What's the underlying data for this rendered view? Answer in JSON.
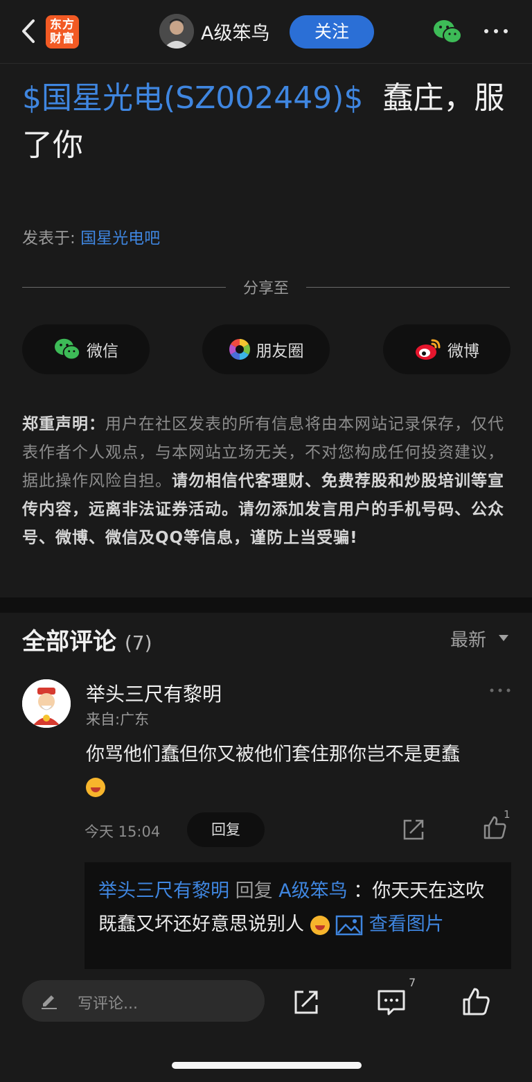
{
  "header": {
    "logo_text": "东方财富",
    "author": "A级笨鸟",
    "follow_label": "关注",
    "icons": [
      "back-icon",
      "wechat-icon",
      "more-icon"
    ]
  },
  "post": {
    "title_stock": "$国星光电(SZ002449)$",
    "title_text": "蠢庄，服了你",
    "posted_label": "发表于:",
    "posted_bar": "国星光电吧"
  },
  "share": {
    "label": "分享至",
    "buttons": [
      {
        "label": "微信",
        "icon": "wechat-icon"
      },
      {
        "label": "朋友圈",
        "icon": "moments-icon"
      },
      {
        "label": "微博",
        "icon": "weibo-icon"
      }
    ]
  },
  "disclaimer": {
    "prefix": "郑重声明：",
    "normal": "用户在社区发表的所有信息将由本网站记录保存，仅代表作者个人观点，与本网站立场无关，不对您构成任何投资建议，据此操作风险自担。",
    "bold": "请勿相信代客理财、免费荐股和炒股培训等宣传内容，远离非法证券活动。请勿添加发言用户的手机号码、公众号、微博、微信及QQ等信息，谨防上当受骗!"
  },
  "comments": {
    "heading": "全部评论",
    "count": "(7)",
    "sort": "最新",
    "items": [
      {
        "name": "举头三尺有黎明",
        "location": "来自:广东",
        "text": "你骂他们蠢但你又被他们套住那你岂不是更蠢",
        "time": "今天 15:04",
        "reply_label": "回复",
        "likes": "1",
        "sub_reply": {
          "from": "举头三尺有黎明",
          "verb": "回复",
          "to": "A级笨鸟",
          "text": "：你天天在这吹既蠢又坏还好意思说别人",
          "link": "查看图片"
        }
      }
    ]
  },
  "bottom": {
    "placeholder": "写评论...",
    "comment_count": "7"
  }
}
